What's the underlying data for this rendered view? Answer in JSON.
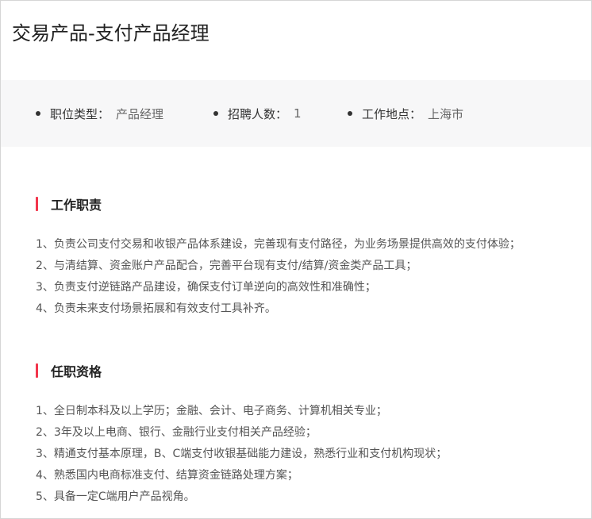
{
  "job": {
    "title": "交易产品-支付产品经理"
  },
  "meta": [
    {
      "label": "职位类型：",
      "value": "产品经理"
    },
    {
      "label": "招聘人数：",
      "value": "1"
    },
    {
      "label": "工作地点：",
      "value": "上海市"
    }
  ],
  "responsibilities": {
    "heading": "工作职责",
    "items": [
      "1、负责公司支付交易和收银产品体系建设，完善现有支付路径，为业务场景提供高效的支付体验；",
      "2、与清结算、资金账户产品配合，完善平台现有支付/结算/资金类产品工具；",
      "3、负责支付逆链路产品建设，确保支付订单逆向的高效性和准确性；",
      "4、负责未来支付场景拓展和有效支付工具补齐。"
    ]
  },
  "qualifications": {
    "heading": "任职资格",
    "items": [
      "1、全日制本科及以上学历；金融、会计、电子商务、计算机相关专业；",
      "2、3年及以上电商、银行、金融行业支付相关产品经验；",
      "3、精通支付基本原理，B、C端支付收银基础能力建设，熟悉行业和支付机构现状；",
      "4、熟悉国内电商标准支付、结算资金链路处理方案；",
      "5、具备一定C端用户产品视角。"
    ]
  },
  "colors": {
    "accent": "#f2364c",
    "meta_background": "#f7f7f8"
  }
}
